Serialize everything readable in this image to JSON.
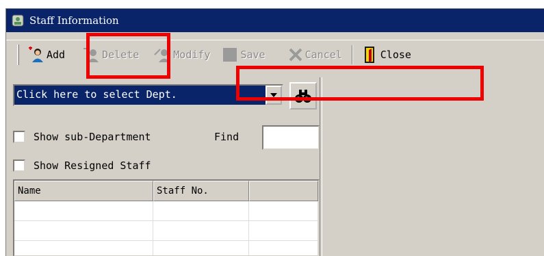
{
  "window": {
    "title": "Staff Information"
  },
  "toolbar": {
    "add_label": "Add",
    "delete_label": "Delete",
    "modify_label": "Modify",
    "save_label": "Save",
    "cancel_label": "Cancel",
    "close_label": "Close"
  },
  "filter": {
    "dept_select_value": "Click here to select Dept.",
    "show_sub_department_label": "Show sub-Department",
    "find_label": "Find",
    "find_value": "",
    "show_resigned_label": "Show Resigned Staff"
  },
  "grid": {
    "columns": [
      "Name",
      "Staff No.",
      ""
    ],
    "rows": [
      [
        "",
        "",
        ""
      ],
      [
        "",
        "",
        ""
      ],
      [
        "",
        "",
        ""
      ]
    ]
  },
  "colors": {
    "title_bar": "#0a246a",
    "window_bg": "#d4d0c8",
    "selection": "#0a246a",
    "highlight_box": "#ee0000"
  },
  "icons": [
    "app-icon",
    "add-user-icon",
    "delete-user-icon",
    "modify-user-icon",
    "save-icon",
    "cancel-icon",
    "close-door-icon",
    "dropdown-arrow-icon",
    "binoculars-icon"
  ]
}
